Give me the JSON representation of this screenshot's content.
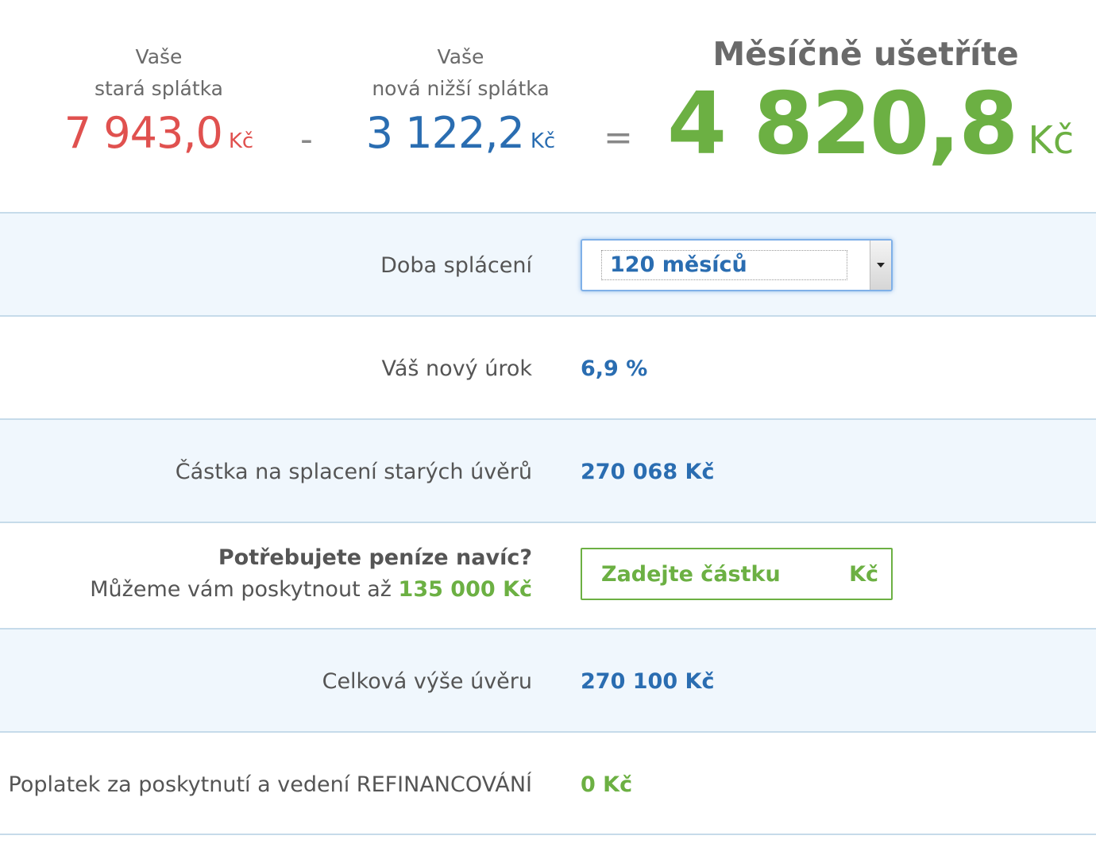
{
  "summary": {
    "old_label_line1": "Vaše",
    "old_label_line2": "stará splátka",
    "old_amount": "7 943,0",
    "old_currency": "Kč",
    "minus": "-",
    "new_label_line1": "Vaše",
    "new_label_line2": "nová nižší splátka",
    "new_amount": "3 122,2",
    "new_currency": "Kč",
    "equals": "=",
    "save_title": "Měsíčně ušetříte",
    "save_amount": "4 820,8",
    "save_currency": "Kč"
  },
  "rows": {
    "term": {
      "label": "Doba splácení",
      "selected": "120 měsíců"
    },
    "rate": {
      "label": "Váš nový úrok",
      "value": "6,9 %"
    },
    "payoff": {
      "label": "Částka na splacení starých úvěrů",
      "value": "270 068 Kč"
    },
    "extra": {
      "question": "Potřebujete peníze navíc?",
      "offer_text": "Můžeme vám poskytnout až",
      "offer_amount": "135 000 Kč",
      "input_placeholder": "Zadejte částku",
      "input_unit": "Kč"
    },
    "total": {
      "label": "Celková výše úvěru",
      "value": "270 100 Kč"
    },
    "fee": {
      "label": "Poplatek za poskytnutí a vedení REFINANCOVÁNÍ",
      "value": "0 Kč"
    }
  },
  "colors": {
    "old": "#e0514f",
    "new": "#2a6db1",
    "save": "#6cb043",
    "alt_row_bg": "#f0f7fd",
    "divider": "#c6dbea"
  },
  "icons": {
    "dropdown": "chevron-down-icon"
  }
}
